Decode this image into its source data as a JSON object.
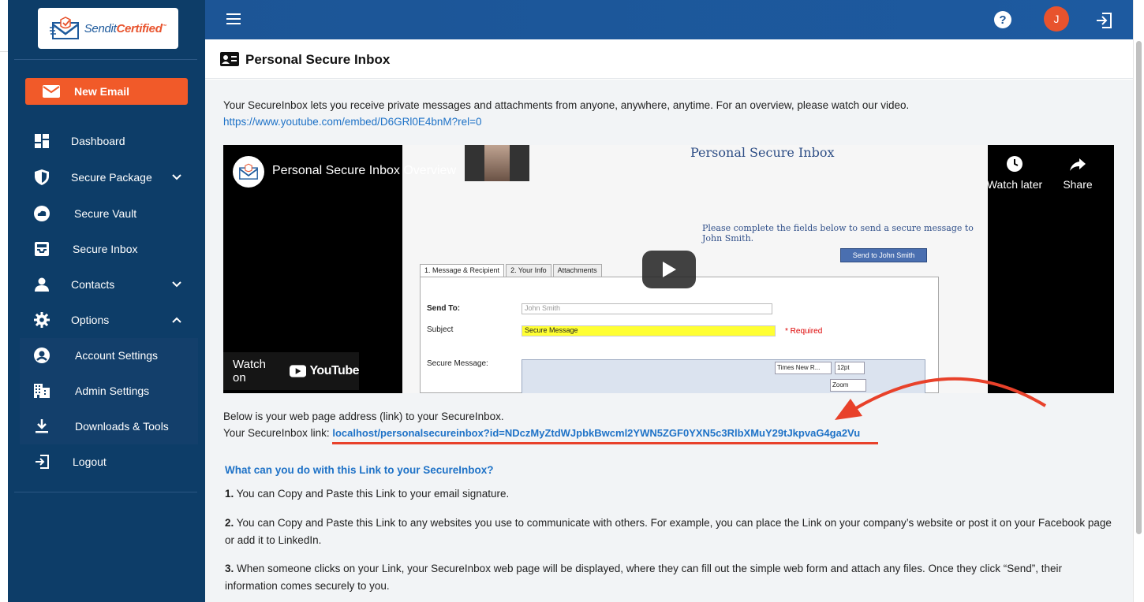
{
  "brand": {
    "name_part1": "Sendit",
    "name_part2": "Certified",
    "tm": "™"
  },
  "sidebar": {
    "new_email_label": "New Email",
    "items": [
      {
        "label": "Dashboard",
        "icon": "dashboard-icon"
      },
      {
        "label": "Secure Package",
        "icon": "shield-icon",
        "expand": "chevron-down-icon"
      },
      {
        "label": "Secure Vault",
        "icon": "cloud-icon"
      },
      {
        "label": "Secure Inbox",
        "icon": "inbox-icon"
      },
      {
        "label": "Contacts",
        "icon": "person-icon",
        "expand": "chevron-down-icon"
      },
      {
        "label": "Options",
        "icon": "gear-icon",
        "expand": "chevron-up-icon"
      }
    ],
    "sub_items": [
      {
        "label": "Account Settings",
        "icon": "account-circle-icon"
      },
      {
        "label": "Admin Settings",
        "icon": "building-icon"
      },
      {
        "label": "Downloads & Tools",
        "icon": "download-icon"
      }
    ],
    "logout_label": "Logout"
  },
  "header": {
    "help": "?",
    "avatar_initial": "J"
  },
  "page": {
    "title": "Personal Secure Inbox",
    "intro_text": "Your SecureInbox lets you receive private messages and attachments from anyone, anywhere, anytime. For an overview, please watch our video.",
    "intro_link": "https://www.youtube.com/embed/D6GRl0E4bnM?rel=0",
    "video": {
      "title": "Personal Secure Inbox Overview",
      "watch_later": "Watch later",
      "share": "Share",
      "watch_on": "Watch on",
      "youtube": "YouTube",
      "screen_heading": "Personal Secure Inbox",
      "screen_line": "Please complete the fields below to send a secure message to John Smith.",
      "screen_button": "Send to John Smith",
      "screen_tabs": [
        "1. Message & Recipient",
        "2. Your Info",
        "Attachments"
      ],
      "send_to_label": "Send To:",
      "send_to_value": "John Smith",
      "subject_label": "Subject",
      "subject_value": "Secure Message",
      "required": "* Required",
      "message_label": "Secure Message:",
      "font_select": "Times New R...",
      "size_select": "12pt",
      "zoom_select": "Zoom"
    },
    "link_intro": "Below is your web page address (link) to your SecureInbox.",
    "link_label": "Your SecureInbox link:",
    "link_value": "localhost/personalsecureinbox?id=NDczMyZtdWJpbkBwcml2YWN5ZGF0YXN5c3RlbXMuY29tJkpvaG4ga2Vu",
    "faq": {
      "question": "What can you do with this Link to your SecureInbox?",
      "items": [
        {
          "num": "1.",
          "text": "You can Copy and Paste this Link to your email signature."
        },
        {
          "num": "2.",
          "text": "You can Copy and Paste this Link to any websites you use to communicate with others. For example, you can place the Link on your company’s website or post it on your Facebook page or add it to LinkedIn."
        },
        {
          "num": "3.",
          "text": "When someone clicks on your Link, your SecureInbox web page will be displayed, where they can fill out the simple web form and attach any files. Once they click “Send”, their information comes securely to you."
        }
      ]
    }
  },
  "colors": {
    "sidebar": "#0d3d68",
    "accent": "#f15a29",
    "topbar": "#1c5596",
    "link": "#1e72c7",
    "annotation": "#e8412a"
  }
}
